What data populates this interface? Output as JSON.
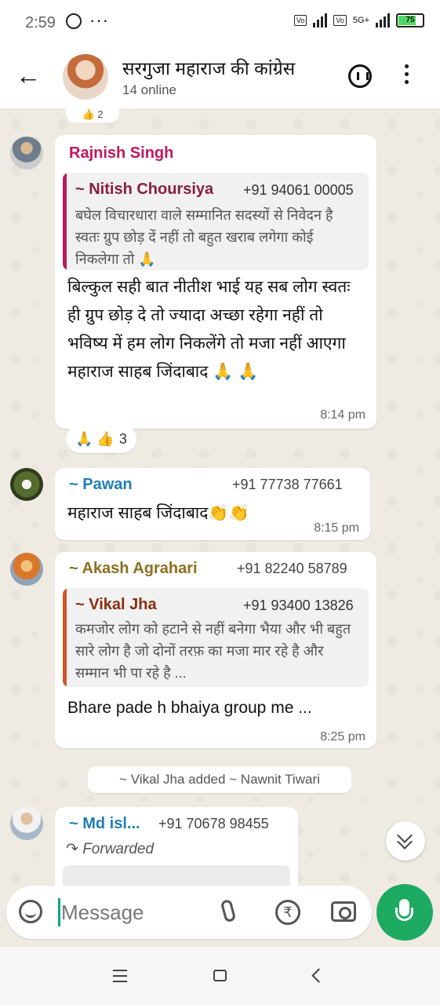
{
  "status_bar": {
    "time": "2:59",
    "dots": "···",
    "net_label": "5G+",
    "battery": "75"
  },
  "header": {
    "title": "सरगुजा महाराज की कांग्रेस",
    "subtitle": "14 online"
  },
  "top_reaction_count": "2",
  "messages": [
    {
      "sender": "Rajnish Singh",
      "sender_color": "#c2185b",
      "quote": {
        "name": "~ Nitish Choursiya",
        "phone": "+91 94061 00005",
        "text": "बघेल विचारधारा वाले सम्मानित सदस्यों से निवेदन है स्वतः ग्रुप छोड़ दें नहीं तो बहुत खराब लगेगा कोई निकलेगा तो 🙏",
        "bar_color": "#b71c5c"
      },
      "text": "बिल्कुल सही बात नीतीश भाई यह सब लोग स्वतः ही ग्रुप छोड़ दे तो ज्यादा अच्छा रहेगा नहीं तो भविष्य में हम लोग निकलेंगे तो मजा नहीं आएगा महाराज साहब जिंदाबाद 🙏 🙏",
      "time": "8:14 pm",
      "reactions": "🙏 👍",
      "reaction_count": "3"
    },
    {
      "sender": "~ Pawan",
      "sender_color": "#1e7fb8",
      "phone": "+91 77738 77661",
      "text": "महाराज साहब जिंदाबाद👏👏",
      "time": "8:15 pm"
    },
    {
      "sender": "~ Akash Agrahari",
      "sender_color": "#8d6e1f",
      "phone": "+91 82240 58789",
      "quote": {
        "name": "~ Vikal Jha",
        "phone": "+91 93400 13826",
        "text": "कमजोर लोग को हटाने से नहीं बनेगा भैया और भी बहुत सारे लोग है जो दोनों तरफ़ का मजा मार रहे है और सम्मान भी पा रहे है ...",
        "bar_color": "#d2572a"
      },
      "text": "Bhare pade h bhaiya group me ...",
      "time": "8:25 pm"
    },
    {
      "sender": "~ Md isl...",
      "sender_color": "#1e7fb8",
      "phone": "+91 70678 98455",
      "forwarded": "Forwarded"
    }
  ],
  "system_message": "~ Vikal Jha added ~ Nawnit Tiwari",
  "input": {
    "placeholder": "Message"
  },
  "colors": {
    "accent": "#00a884",
    "mic": "#1daa61",
    "background": "#efeae2"
  }
}
